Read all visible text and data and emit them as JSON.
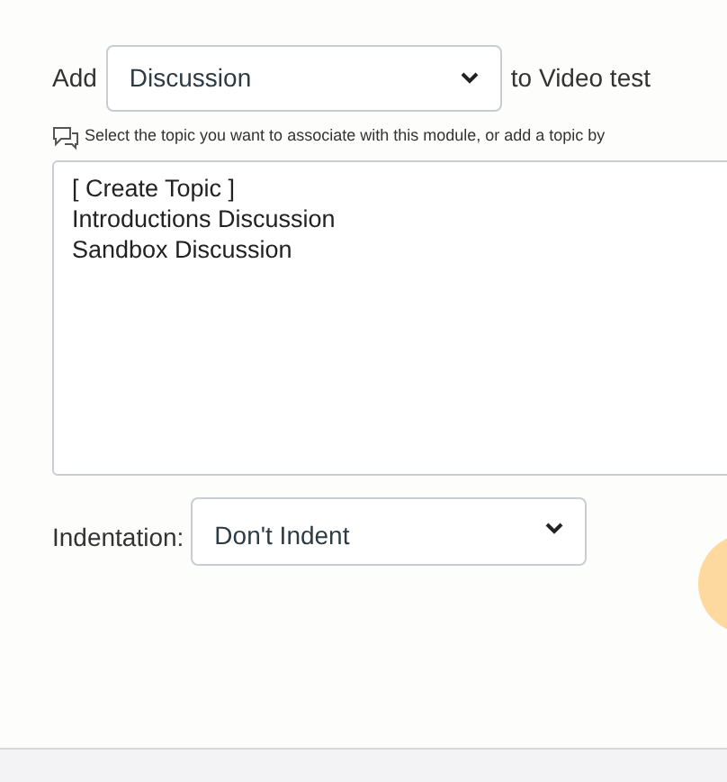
{
  "add_row": {
    "label": "Add",
    "type_select": {
      "value": "Discussion"
    },
    "suffix": "to Video test"
  },
  "hint": "Select the topic you want to associate with this module, or add a topic by",
  "topic_list": [
    {
      "label": "[ Create Topic ]",
      "selected": false
    },
    {
      "label": "Introductions Discussion",
      "selected": false
    },
    {
      "label": "Sandbox Discussion",
      "selected": false
    }
  ],
  "indentation": {
    "label": "Indentation:",
    "value": "Don't Indent"
  }
}
